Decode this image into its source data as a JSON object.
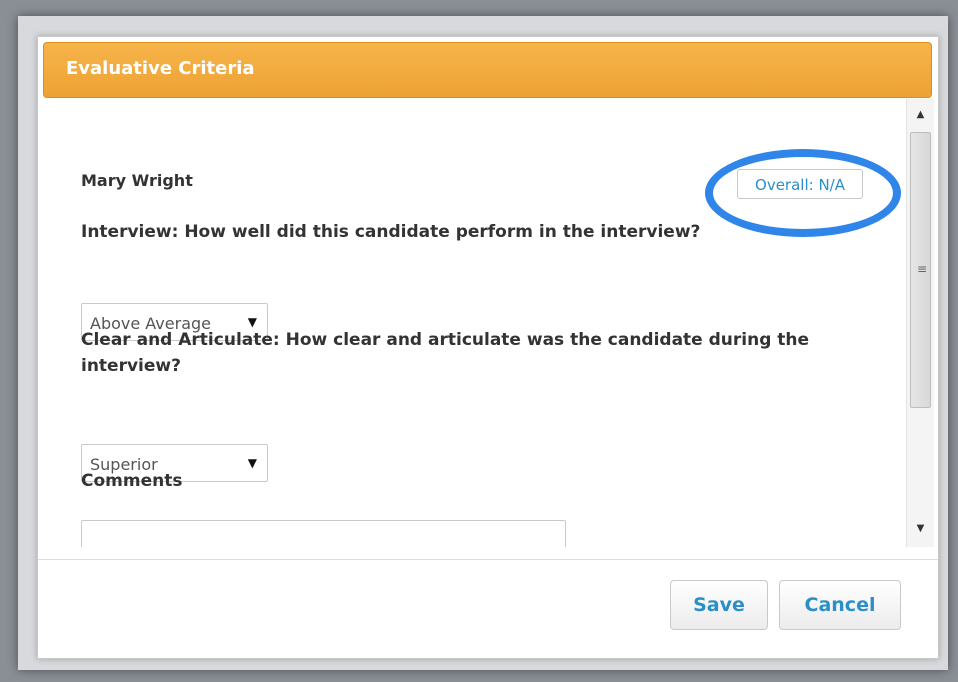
{
  "dialog": {
    "title": "Evaluative Criteria"
  },
  "candidate": {
    "name": "Mary Wright",
    "overall_label": "Overall: N/A"
  },
  "questions": [
    {
      "text": "Interview: How well did this candidate perform in the interview?",
      "selected": "Above Average"
    },
    {
      "text": "Clear and Articulate: How clear and articulate was the candidate during the interview?",
      "selected": "Superior"
    }
  ],
  "comments": {
    "label": "Comments",
    "value": ""
  },
  "footer": {
    "save_label": "Save",
    "cancel_label": "Cancel"
  },
  "colors": {
    "header_orange": "#eda234",
    "link_blue": "#2b8fc7",
    "highlight_ring": "#2f86e8"
  }
}
